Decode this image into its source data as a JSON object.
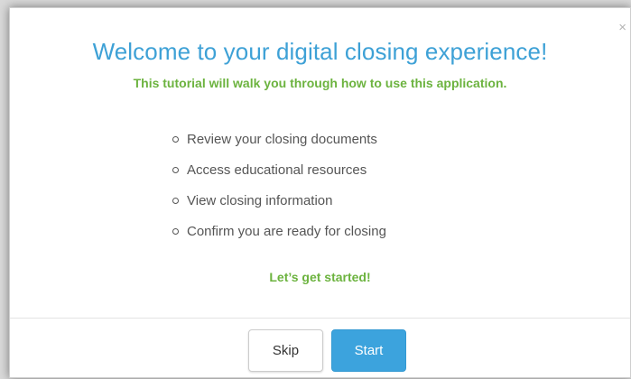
{
  "modal": {
    "close_label": "×",
    "title": "Welcome to your digital closing experience!",
    "subtitle": "This tutorial will walk you through how to use this application.",
    "items": [
      {
        "label": "Review your closing documents"
      },
      {
        "label": "Access educational resources"
      },
      {
        "label": "View closing information"
      },
      {
        "label": "Confirm you are ready for closing"
      }
    ],
    "cta": "Let’s get started!",
    "skip_label": "Skip",
    "start_label": "Start"
  },
  "colors": {
    "title": "#3ea1d6",
    "accent_green": "#6cb33f",
    "primary_button": "#3ca3dd",
    "text": "#555555"
  },
  "icons": {
    "close": "close-icon",
    "bullet": "circle-bullet-icon"
  }
}
